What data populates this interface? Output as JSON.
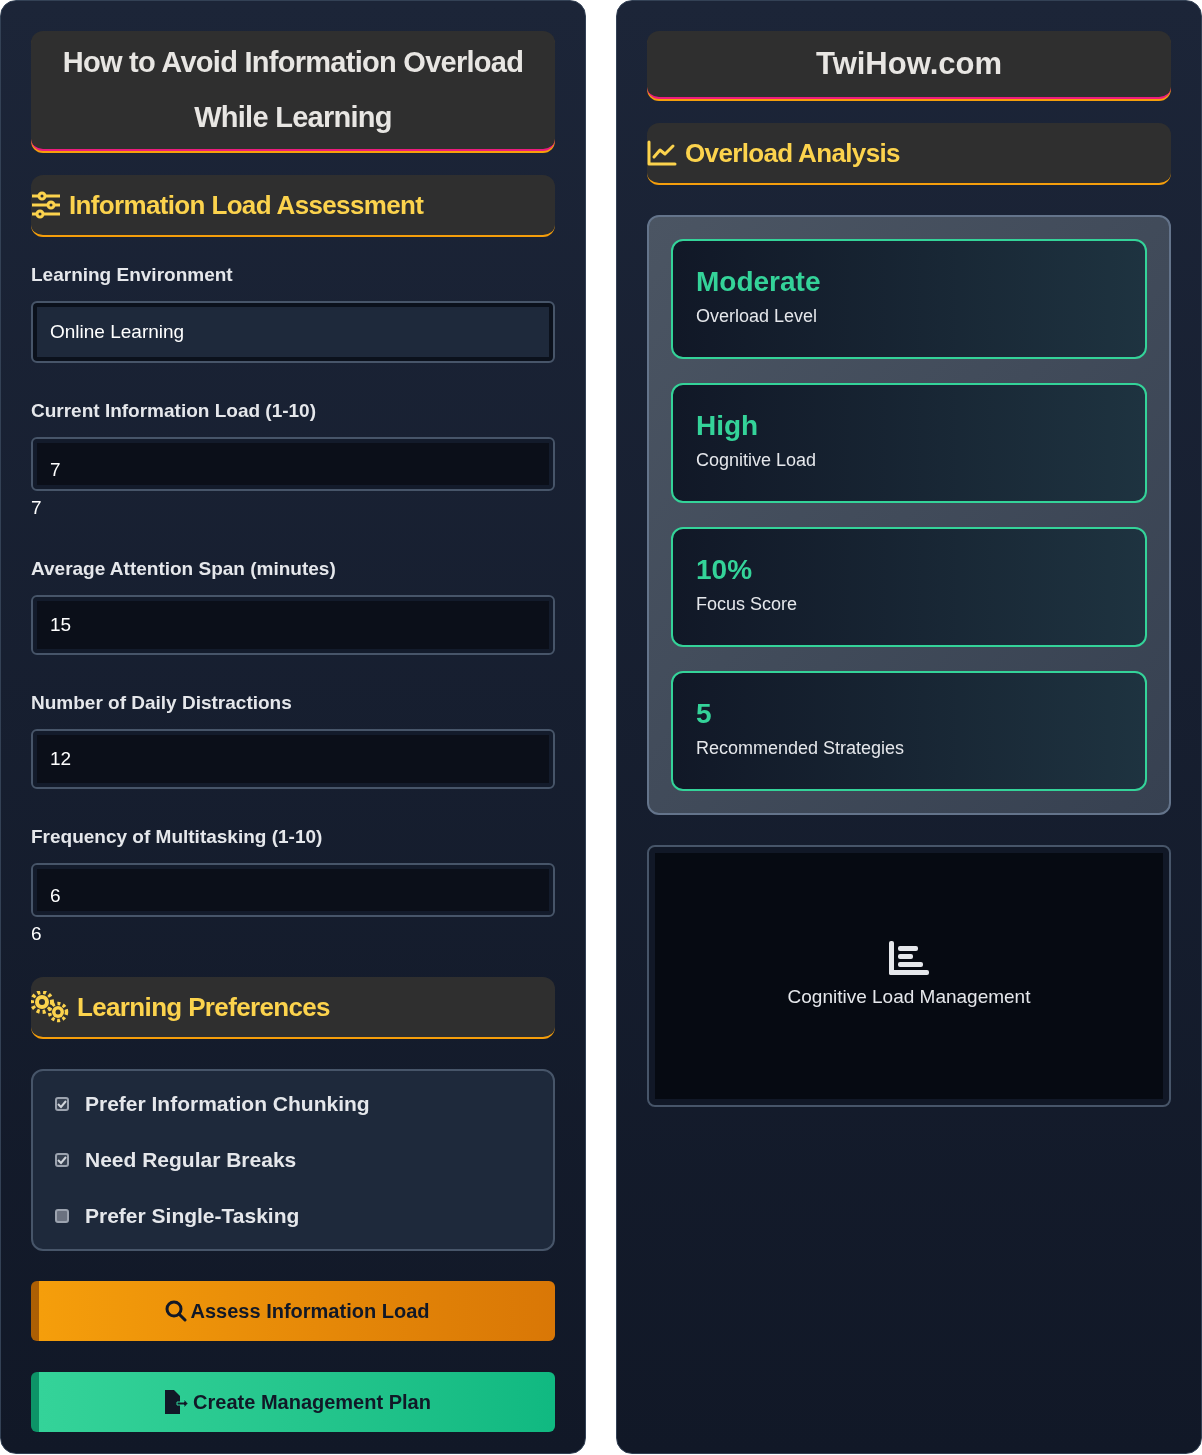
{
  "left_panel": {
    "title": "How to Avoid Information Overload While Learning",
    "assessment": {
      "heading": "Information Load Assessment",
      "fields": [
        {
          "kind": "select",
          "label": "Learning Environment",
          "value": "Online Learning"
        },
        {
          "kind": "range",
          "label": "Current Information Load (1-10)",
          "value": "7",
          "reading": "7"
        },
        {
          "kind": "number",
          "label": "Average Attention Span (minutes)",
          "value": "15"
        },
        {
          "kind": "number",
          "label": "Number of Daily Distractions",
          "value": "12"
        },
        {
          "kind": "range",
          "label": "Frequency of Multitasking (1-10)",
          "value": "6",
          "reading": "6"
        }
      ]
    },
    "preferences": {
      "heading": "Learning Preferences",
      "options": [
        {
          "label": "Prefer Information Chunking",
          "checked": true
        },
        {
          "label": "Need Regular Breaks",
          "checked": true
        },
        {
          "label": "Prefer Single-Tasking",
          "checked": false
        }
      ]
    },
    "buttons": [
      {
        "kind": "assess",
        "label": "Assess Information Load"
      },
      {
        "kind": "plan",
        "label": "Create Management Plan"
      }
    ]
  },
  "right_panel": {
    "title": "TwiHow.com",
    "heading": "Overload Analysis",
    "results": [
      {
        "value": "Moderate",
        "label": "Overload Level"
      },
      {
        "value": "High",
        "label": "Cognitive Load"
      },
      {
        "value": "10%",
        "label": "Focus Score"
      },
      {
        "value": "5",
        "label": "Recommended Strategies"
      }
    ],
    "chart_placeholder": {
      "label": "Cognitive Load Management"
    }
  }
}
